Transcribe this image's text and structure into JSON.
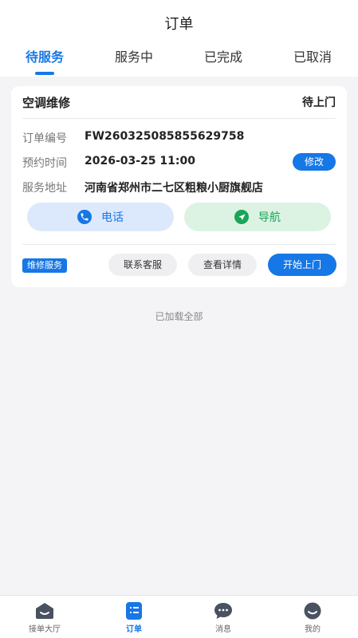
{
  "header": {
    "title": "订单",
    "tabs": [
      "待服务",
      "服务中",
      "已完成",
      "已取消"
    ],
    "active_tab": 0
  },
  "order": {
    "title": "空调维修",
    "status": "待上门",
    "fields": [
      {
        "label": "订单编号",
        "value": "FW26032508585562975​8"
      },
      {
        "label": "预约时间",
        "value": "2026-03-25 11:00"
      },
      {
        "label": "服务地址",
        "value": "河南省郑州市二七区粗粮小厨旗舰店"
      }
    ],
    "modify_label": "修改",
    "call_label": "电话",
    "nav_label": "导航",
    "tag": "维修服务",
    "contact_label": "联系客服",
    "detail_label": "查看详情",
    "start_label": "开始上门"
  },
  "list_footer": "已加载全部",
  "bottom_nav": {
    "items": [
      {
        "label": "接单大厅",
        "icon": "hall-icon"
      },
      {
        "label": "订单",
        "icon": "order-icon"
      },
      {
        "label": "消息",
        "icon": "message-icon"
      },
      {
        "label": "我的",
        "icon": "profile-icon"
      }
    ],
    "active": 1
  },
  "colors": {
    "accent": "#1677e6",
    "nav_green": "#1aa55a",
    "background": "#f4f4f6"
  }
}
